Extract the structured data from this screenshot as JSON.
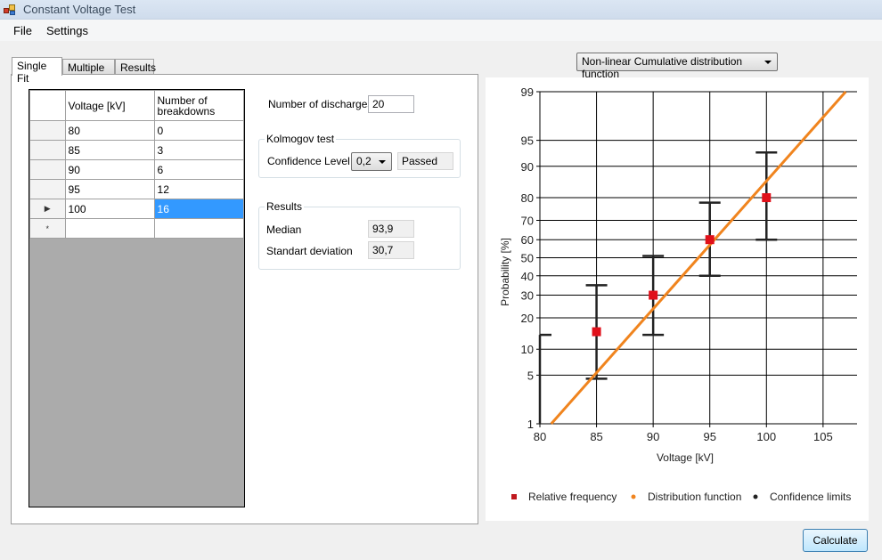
{
  "window": {
    "title": "Constant Voltage Test"
  },
  "menu": [
    "File",
    "Settings"
  ],
  "tabs": [
    {
      "label": "Single Fit",
      "active": true
    },
    {
      "label": "Multiple fit",
      "active": false
    },
    {
      "label": "Results",
      "active": false
    }
  ],
  "table": {
    "columns": [
      "Voltage [kV]",
      "Number of breakdowns"
    ],
    "rows": [
      {
        "voltage": "80",
        "breakdowns": "0"
      },
      {
        "voltage": "85",
        "breakdowns": "3"
      },
      {
        "voltage": "90",
        "breakdowns": "6"
      },
      {
        "voltage": "95",
        "breakdowns": "12"
      },
      {
        "voltage": "100",
        "breakdowns": "16",
        "current": true,
        "selected_cell": "breakdowns"
      }
    ],
    "new_row_marker": "*"
  },
  "discharges": {
    "label": "Number of discharges",
    "value": "20"
  },
  "kolmogov": {
    "title": "Kolmogov test",
    "confidence_label": "Confidence Level",
    "confidence_value": "0,2",
    "status": "Passed"
  },
  "results": {
    "title": "Results",
    "median_label": "Median",
    "median_value": "93,9",
    "std_label": "Standart deviation",
    "std_value": "30,7"
  },
  "chart_type_select": "Non-linear Cumulative distribution function",
  "calculate_label": "Calculate",
  "colors": {
    "relative": "#e0101a",
    "distribution": "#f0841e",
    "confidence": "#222222"
  },
  "chart_data": {
    "type": "scatter",
    "title": "",
    "xlabel": "Voltage [kV]",
    "ylabel": "Probability [%]",
    "xlim": [
      80,
      108
    ],
    "ylim": [
      1,
      99
    ],
    "y_scale": "probability",
    "x_ticks": [
      80,
      85,
      90,
      95,
      100,
      105
    ],
    "y_ticks": [
      1,
      5,
      10,
      20,
      30,
      40,
      50,
      60,
      70,
      80,
      90,
      95,
      99
    ],
    "grid": true,
    "legend": [
      "Relative frequency",
      "Distribution function",
      "Confidence limits"
    ],
    "legend_position": "bottom",
    "series": [
      {
        "name": "Relative frequency",
        "x": [
          85,
          90,
          95,
          100
        ],
        "y": [
          15,
          30,
          60,
          80
        ]
      },
      {
        "name": "Distribution function",
        "x": [
          81,
          107
        ],
        "y": [
          1,
          99
        ]
      },
      {
        "name": "Confidence limits",
        "x": [
          80,
          85,
          90,
          95,
          100
        ],
        "lower": [
          1,
          4.5,
          14,
          40,
          60
        ],
        "upper": [
          14,
          35,
          51,
          78,
          93
        ]
      }
    ]
  }
}
